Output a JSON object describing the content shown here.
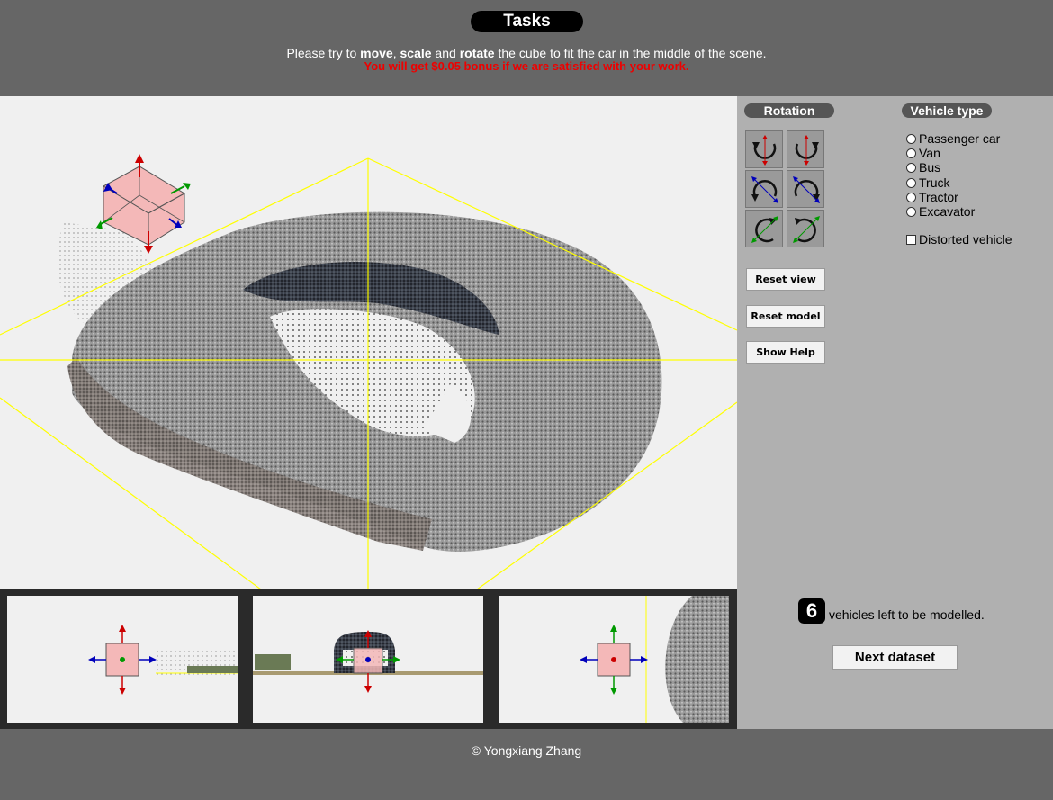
{
  "header": {
    "title": "Tasks",
    "instruction_parts": [
      "Please try to ",
      "move",
      ", ",
      "scale",
      " and ",
      "rotate",
      " the cube to fit the car in the middle of the scene."
    ],
    "bonus": "You will get $0.05 bonus if we are satisfied with your work."
  },
  "rotation": {
    "label": "Rotation"
  },
  "vehicle_type": {
    "label": "Vehicle type",
    "options": [
      "Passenger car",
      "Van",
      "Bus",
      "Truck",
      "Tractor",
      "Excavator"
    ],
    "selected": null,
    "distorted_label": "Distorted vehicle",
    "distorted_checked": false
  },
  "actions": {
    "reset_view": "Reset view",
    "reset_model": "Reset model",
    "show_help": "Show Help"
  },
  "status": {
    "remaining_count": "6",
    "remaining_text": "vehicles left to be modelled."
  },
  "next_button": "Next dataset",
  "footer": {
    "copyright": "© Yongxiang Zhang"
  },
  "colors": {
    "background": "#666666",
    "panel": "#b0b0b0",
    "viewport": "#f0f0f0",
    "bonus": "#ee0000",
    "bounding_lines": "#ffff00",
    "cube_fill": "#f4b8b8",
    "axis_red": "#cc0000",
    "axis_green": "#009900",
    "axis_blue": "#0000bb"
  }
}
